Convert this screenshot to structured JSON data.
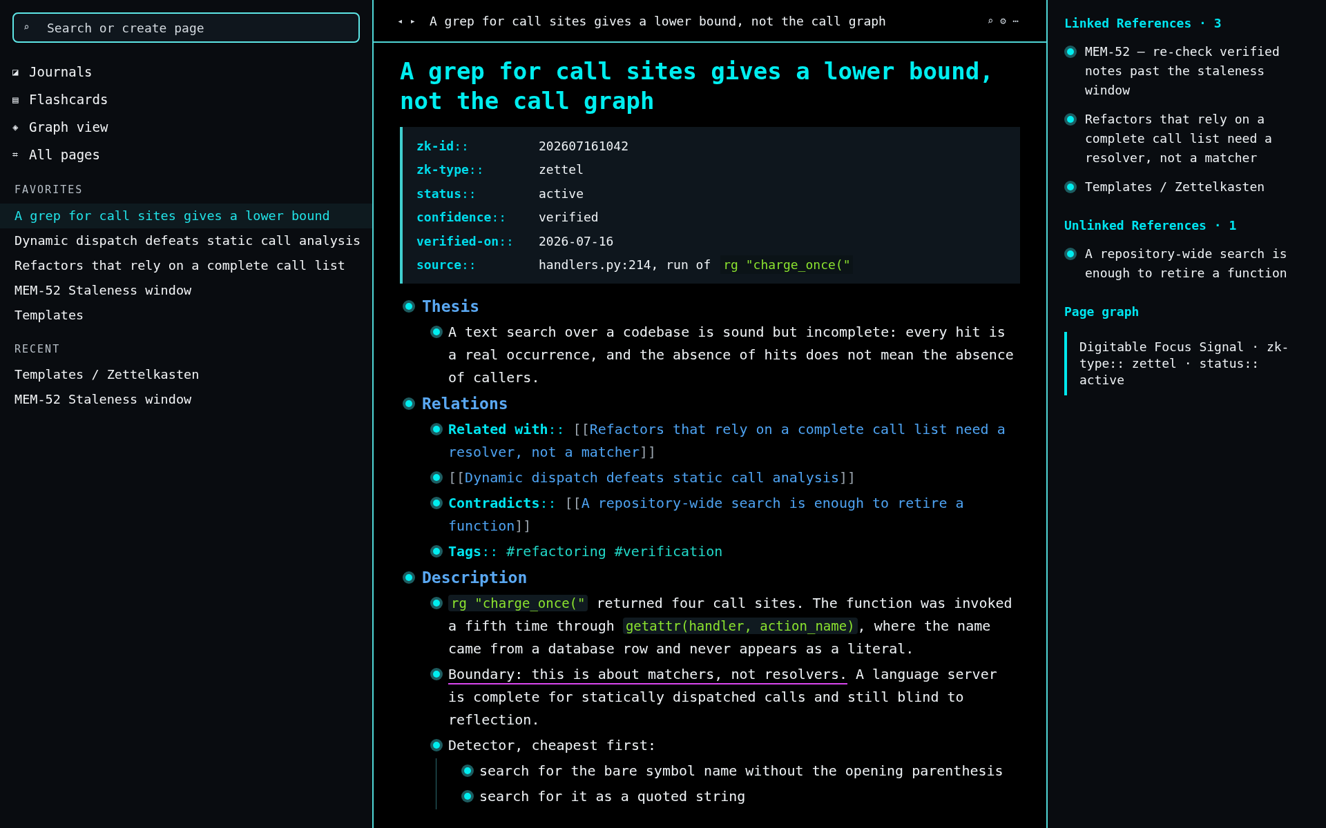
{
  "search": {
    "icon": "⌕",
    "placeholder": "Search or create page"
  },
  "nav": [
    {
      "glyph": "◪",
      "label": "Journals"
    },
    {
      "glyph": "▤",
      "label": "Flashcards"
    },
    {
      "glyph": "◈",
      "label": "Graph view"
    },
    {
      "glyph": "⌗",
      "label": "All pages"
    }
  ],
  "favorites": {
    "heading": "FAVORITES",
    "items": [
      {
        "label": "A grep for call sites gives a lower bound",
        "selected": true
      },
      {
        "label": "Dynamic dispatch defeats static call analysis",
        "selected": false
      },
      {
        "label": "Refactors that rely on a complete call list",
        "selected": false
      },
      {
        "label": "MEM-52 Staleness window",
        "selected": false
      },
      {
        "label": "Templates",
        "selected": false
      }
    ]
  },
  "recent": {
    "heading": "RECENT",
    "items": [
      {
        "label": "Templates / Zettelkasten",
        "selected": false
      },
      {
        "label": "MEM-52 Staleness window",
        "selected": false
      }
    ]
  },
  "topbar": {
    "back": "◂",
    "forward": "▸",
    "title": "A grep for call sites gives a lower bound, not the call graph",
    "actions": [
      "⌕",
      "⚙",
      "⋯"
    ]
  },
  "page": {
    "title": "A grep for call sites gives a lower bound, not the call graph",
    "properties": [
      {
        "key": "zk-id",
        "sep": "::",
        "value": "202607161042"
      },
      {
        "key": "zk-type",
        "sep": "::",
        "value": "zettel"
      },
      {
        "key": "status",
        "sep": "::",
        "value": "active"
      },
      {
        "key": "confidence",
        "sep": "::",
        "value": "verified"
      },
      {
        "key": "verified-on",
        "sep": "::",
        "value": "2026-07-16"
      },
      {
        "key": "source",
        "sep": "::",
        "value": "handlers.py:214, run of",
        "code": "rg \"charge_once(\""
      }
    ],
    "outline": [
      {
        "heading": "Thesis",
        "children": [
          {
            "segments": [
              {
                "kind": "text",
                "text": "A text search over a codebase is sound but incomplete: every hit is a real occurrence, and the absence of hits does not mean the absence of callers."
              }
            ]
          }
        ]
      },
      {
        "heading": "Relations",
        "children": [
          {
            "segments": [
              {
                "kind": "prop",
                "key": "Related with",
                "sep": "::"
              },
              {
                "kind": "link",
                "open": "[[",
                "lines": [
                  "Refactors that rely on a complete call list need a",
                  "resolver, not a matcher"
                ],
                "close": "]]"
              }
            ]
          },
          {
            "segments": [
              {
                "kind": "link",
                "open": "[[",
                "lines": [
                  "Dynamic dispatch defeats static call analysis"
                ],
                "close": "]]"
              }
            ]
          },
          {
            "segments": [
              {
                "kind": "prop",
                "key": "Contradicts",
                "sep": "::"
              },
              {
                "kind": "link",
                "open": "[[",
                "lines": [
                  "A repository-wide search is enough to retire a",
                  "function"
                ],
                "close": "]]"
              }
            ]
          },
          {
            "segments": [
              {
                "kind": "prop",
                "key": "Tags",
                "sep": "::"
              },
              {
                "kind": "tag",
                "text": "#refactoring"
              },
              {
                "kind": "tag",
                "text": "#verification"
              }
            ]
          }
        ]
      },
      {
        "heading": "Description",
        "children": [
          {
            "segments": [
              {
                "kind": "code",
                "text": "rg \"charge_once(\""
              },
              {
                "kind": "text",
                "text": " returned four call sites. The function was invoked a fifth time through "
              },
              {
                "kind": "code",
                "text": "getattr(handler, action_name)"
              },
              {
                "kind": "text",
                "text": ", where the name came from a database row and never appears as a literal."
              }
            ]
          },
          {
            "segments": [
              {
                "kind": "underline",
                "text": "Boundary: this is about matchers, not resolvers."
              },
              {
                "kind": "text",
                "text": " A language server is complete for statically dispatched calls and still blind to reflection."
              }
            ]
          },
          {
            "segments": [
              {
                "kind": "text",
                "text": "Detector, cheapest first:"
              }
            ],
            "children": [
              {
                "segments": [
                  {
                    "kind": "text",
                    "text": "search for the bare symbol name without the opening parenthesis"
                  }
                ]
              },
              {
                "segments": [
                  {
                    "kind": "text",
                    "text": "search for it as a quoted string"
                  }
                ]
              }
            ]
          }
        ]
      }
    ]
  },
  "right": {
    "linked": {
      "heading": "Linked References · 3",
      "items": [
        "MEM-52 — re-check verified notes past the staleness window",
        "Refactors that rely on a complete call list need a resolver, not a matcher",
        "Templates / Zettelkasten"
      ]
    },
    "unlinked": {
      "heading": "Unlinked References · 1",
      "items": [
        "A repository-wide search is enough to retire a function"
      ]
    },
    "graph": {
      "heading": "Page graph",
      "text": "Digitable Focus Signal · zk-type:: zettel · status:: active"
    }
  }
}
